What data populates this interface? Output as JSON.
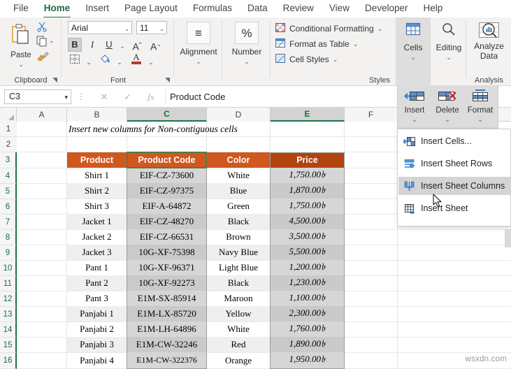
{
  "ribbon": {
    "tabs": [
      {
        "label": "File",
        "active": false
      },
      {
        "label": "Home",
        "active": true
      },
      {
        "label": "Insert",
        "active": false
      },
      {
        "label": "Page Layout",
        "active": false
      },
      {
        "label": "Formulas",
        "active": false
      },
      {
        "label": "Data",
        "active": false
      },
      {
        "label": "Review",
        "active": false
      },
      {
        "label": "View",
        "active": false
      },
      {
        "label": "Developer",
        "active": false
      },
      {
        "label": "Help",
        "active": false
      }
    ],
    "groups": {
      "clipboard": {
        "label": "Clipboard",
        "paste_label": "Paste",
        "caret": "⌄"
      },
      "font": {
        "label": "Font",
        "font_name": "Arial",
        "font_size": "11",
        "bold": "B",
        "italic": "I",
        "underline": "U",
        "grow_font": "A",
        "shrink_font": "A",
        "borders": "▦",
        "fill_color": "A",
        "font_color": "A"
      },
      "alignment": {
        "label": "Alignment",
        "button": "Alignment",
        "icon": "≡",
        "caret": "⌄"
      },
      "number": {
        "label": "Number",
        "button": "Number",
        "icon": "%",
        "caret": "⌄"
      },
      "styles": {
        "label": "Styles",
        "items": [
          {
            "label": "Conditional Formatting",
            "caret": "⌄"
          },
          {
            "label": "Format as Table",
            "caret": "⌄"
          },
          {
            "label": "Cell Styles",
            "caret": "⌄"
          }
        ]
      },
      "cells": {
        "label": "Cells",
        "caret": "⌄"
      },
      "editing": {
        "label": "Editing",
        "caret": "⌄"
      },
      "analysis": {
        "label": "Analysis",
        "button_line1": "Analyze",
        "button_line2": "Data"
      }
    }
  },
  "formula_bar": {
    "name_box": "C3",
    "name_box_caret": "▾",
    "cancel_icon": "✕",
    "enter_icon": "✓",
    "fx_icon": "fx",
    "formula_value": "Product Code",
    "formula_placeholder": ""
  },
  "sheet": {
    "columns": [
      {
        "label": "A",
        "selected": false
      },
      {
        "label": "B",
        "selected": false
      },
      {
        "label": "C",
        "selected": true
      },
      {
        "label": "D",
        "selected": false
      },
      {
        "label": "E",
        "selected": true
      },
      {
        "label": "F",
        "selected": false
      }
    ],
    "rows": [
      "1",
      "2",
      "3",
      "4",
      "5",
      "6",
      "7",
      "8",
      "9",
      "10",
      "11",
      "12",
      "13",
      "14",
      "15",
      "16"
    ],
    "title_cell": "Insert new columns for Non-contiguous cells",
    "table_headers": [
      "Product",
      "Product Code",
      "Color",
      "Price"
    ],
    "table_rows": [
      {
        "product": "Shirt 1",
        "code": "EIF-CZ-73600",
        "color": "White",
        "price": "1,750.00৳"
      },
      {
        "product": "Shirt 2",
        "code": "EIF-CZ-97375",
        "color": "Blue",
        "price": "1,870.00৳"
      },
      {
        "product": "Shirt 3",
        "code": "EIF-A-64872",
        "color": "Green",
        "price": "1,750.00৳"
      },
      {
        "product": "Jacket 1",
        "code": "EIF-CZ-48270",
        "color": "Black",
        "price": "4,500.00৳"
      },
      {
        "product": "Jacket 2",
        "code": "EIF-CZ-66531",
        "color": "Brown",
        "price": "3,500.00৳"
      },
      {
        "product": "Jacket 3",
        "code": "10G-XF-75398",
        "color": "Navy Blue",
        "price": "5,500.00৳"
      },
      {
        "product": "Pant 1",
        "code": "10G-XF-96371",
        "color": "Light Blue",
        "price": "1,200.00৳"
      },
      {
        "product": "Pant 2",
        "code": "10G-XF-92273",
        "color": "Black",
        "price": "1,230.00৳"
      },
      {
        "product": "Pant 3",
        "code": "E1M-SX-85914",
        "color": "Maroon",
        "price": "1,100.00৳"
      },
      {
        "product": "Panjabi 1",
        "code": "E1M-LX-85720",
        "color": "Yellow",
        "price": "2,300.00৳"
      },
      {
        "product": "Panjabi 2",
        "code": "E1M-LH-64896",
        "color": "White",
        "price": "1,760.00৳"
      },
      {
        "product": "Panjabi 3",
        "code": "E1M-CW-32246",
        "color": "Red",
        "price": "1,890.00৳"
      },
      {
        "product": "Panjabi 4",
        "code": "E1M-CW-322376",
        "color": "Orange",
        "price": "1,950.00৳"
      }
    ],
    "header_fill": "#d0581f",
    "price_header_fill": "#b0430e",
    "selection_fill": "#d6d6d6",
    "accent": "#217346"
  },
  "insert_panel": {
    "buttons": [
      {
        "label": "Insert",
        "caret": "⌄"
      },
      {
        "label": "Delete",
        "caret": "⌄"
      },
      {
        "label": "Format",
        "caret": "⌄"
      }
    ]
  },
  "insert_menu": {
    "items": [
      {
        "label": "Insert Cells...",
        "pre": "",
        "key": "I",
        "post": "nsert Cells...",
        "hover": false
      },
      {
        "label": "Insert Sheet Rows",
        "pre": "Insert Sheet ",
        "key": "R",
        "post": "ows",
        "hover": false
      },
      {
        "label": "Insert Sheet Columns",
        "pre": "Insert Sheet ",
        "key": "C",
        "post": "olumns",
        "hover": true
      },
      {
        "label": "Insert Sheet",
        "pre": "Ins",
        "key": "e",
        "post": "rt Sheet",
        "hover": false
      }
    ]
  },
  "watermark": "wsxdn.com"
}
